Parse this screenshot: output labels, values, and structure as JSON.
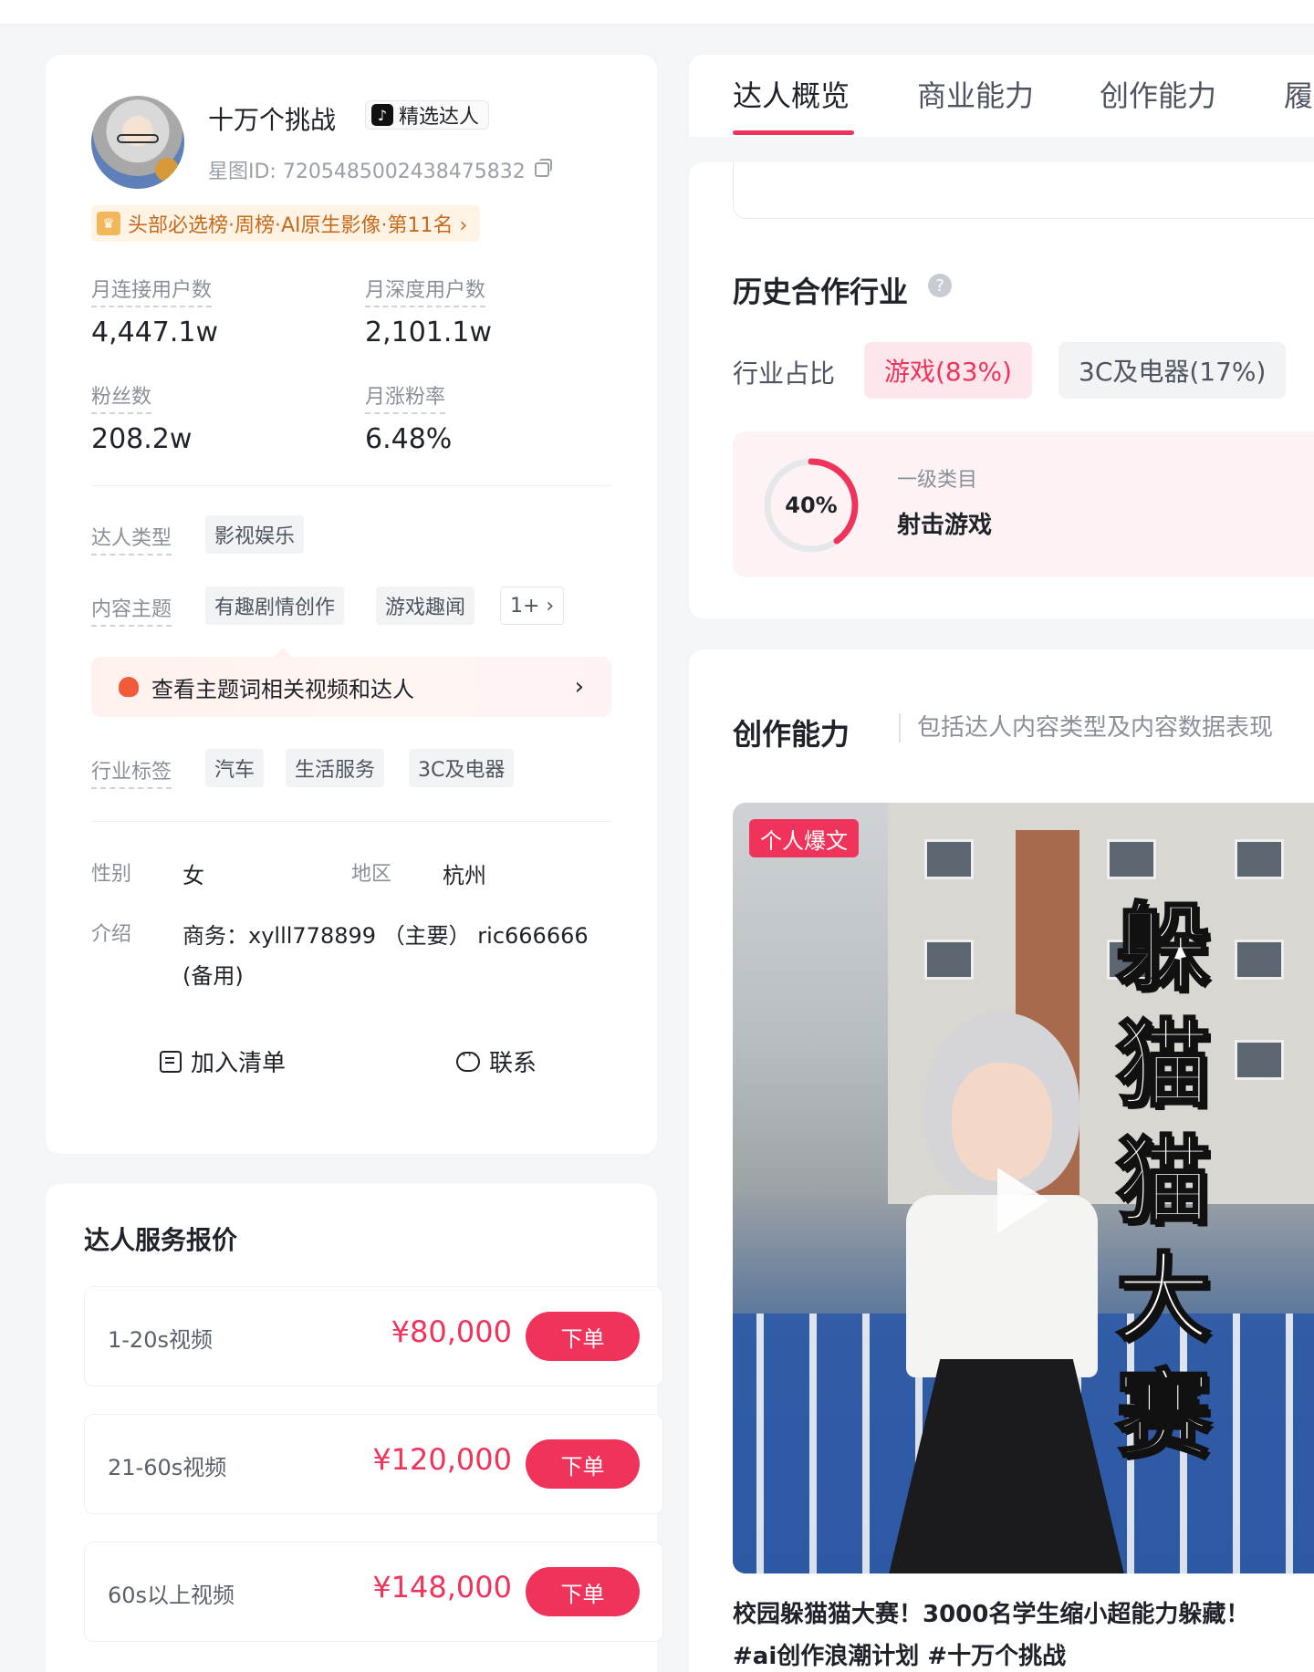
{
  "profile": {
    "name": "十万个挑战",
    "badge": "精选达人",
    "star_id": "星图ID: 7205485002438475832",
    "rank": "头部必选榜·周榜·AI原生影像·第11名 ›",
    "stats": [
      {
        "label": "月连接用户数",
        "value": "4,447.1w"
      },
      {
        "label": "月深度用户数",
        "value": "2,101.1w"
      },
      {
        "label": "粉丝数",
        "value": "208.2w"
      },
      {
        "label": "月涨粉率",
        "value": "6.48%"
      }
    ],
    "type_label": "达人类型",
    "type_chips": [
      "影视娱乐"
    ],
    "topic_label": "内容主题",
    "topic_chips": [
      "有趣剧情创作",
      "游戏趣闻"
    ],
    "topic_more": "1+ ›",
    "topic_bar": "查看主题词相关视频和达人",
    "industry_label": "行业标签",
    "industry_chips": [
      "汽车",
      "生活服务",
      "3C及电器"
    ],
    "gender_label": "性别",
    "gender": "女",
    "region_label": "地区",
    "region": "杭州",
    "intro_label": "介绍",
    "intro_line1": "商务：xylll778899 （主要） ric666666",
    "intro_line2": "(备用)",
    "add_list": "加入清单",
    "contact": "联系"
  },
  "pricing": {
    "title": "达人服务报价",
    "items": [
      {
        "label": "1-20s视频",
        "price": "¥80,000",
        "button": "下单"
      },
      {
        "label": "21-60s视频",
        "price": "¥120,000",
        "button": "下单"
      },
      {
        "label": "60s以上视频",
        "price": "¥148,000",
        "button": "下单"
      }
    ]
  },
  "tabs": [
    "达人概览",
    "商业能力",
    "创作能力",
    "履"
  ],
  "industry": {
    "title": "历史合作行业",
    "help": "?",
    "ratio_label": "行业占比",
    "ratios": [
      "游戏(83%)",
      "3C及电器(17%)"
    ],
    "donut_value": "40%",
    "donut_fraction": 0.4,
    "category_sub": "一级类目",
    "category_name": "射击游戏"
  },
  "creation": {
    "title": "创作能力",
    "desc": "包括达人内容类型及内容数据表现",
    "video_tag": "个人爆文",
    "video_title": "躲猫猫大赛",
    "caption_line1": "校园躲猫猫大赛！3000名学生缩小超能力躲藏！",
    "caption_line2": "#ai创作浪潮计划 #十万个挑战"
  },
  "colors": {
    "accent": "#f0335a",
    "rank": "#c66a1a"
  }
}
